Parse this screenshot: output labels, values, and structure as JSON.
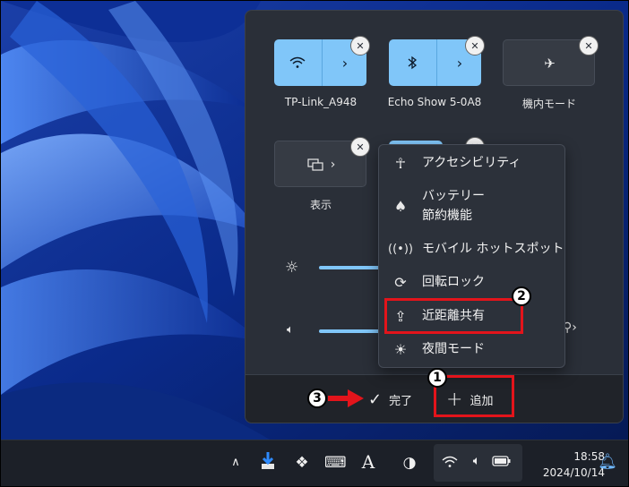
{
  "quick_settings": {
    "tiles": [
      {
        "label": "TP-Link_A948",
        "icon": "wifi-icon",
        "state": "on"
      },
      {
        "label": "Echo Show 5-0A8",
        "icon": "bluetooth-icon",
        "state": "on"
      },
      {
        "label": "機内モード",
        "icon": "airplane-icon",
        "state": "off"
      },
      {
        "label": "表示",
        "icon": "display-icon",
        "state": "off"
      }
    ],
    "brightness_icon": "brightness-icon",
    "volume_icon": "volume-icon"
  },
  "add_menu": {
    "items": [
      {
        "label": "アクセシビリティ",
        "icon": "accessibility-icon"
      },
      {
        "label_line1": "バッテリー",
        "label_line2": "節約機能",
        "icon": "battery-saver-icon"
      },
      {
        "label": "モバイル ホットスポット",
        "icon": "hotspot-icon"
      },
      {
        "label": "回転ロック",
        "icon": "rotation-lock-icon"
      },
      {
        "label": "近距離共有",
        "icon": "nearby-share-icon"
      },
      {
        "label": "夜間モード",
        "icon": "night-light-icon"
      }
    ]
  },
  "footer": {
    "done_label": "完了",
    "add_label": "追加"
  },
  "annotations": {
    "step1": "1",
    "step2": "2",
    "step3": "3",
    "highlight_color": "#e3141b"
  },
  "taskbar": {
    "time": "18:58",
    "date": "2024/10/14",
    "ime_label": "A"
  }
}
